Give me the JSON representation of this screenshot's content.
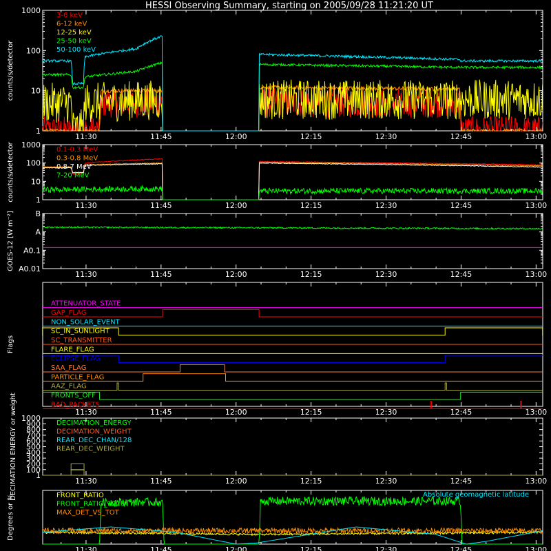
{
  "title": "HESSI Observing Summary, starting on 2005/09/28 11:21:20 UT",
  "time_axis": {
    "tick_labels": [
      "11:30",
      "11:45",
      "12:00",
      "12:15",
      "12:30",
      "12:45",
      "13:00"
    ],
    "tick_minutes": [
      30,
      45,
      60,
      75,
      90,
      105,
      120
    ],
    "range_minutes": [
      21.33,
      121.33
    ]
  },
  "colors": {
    "red": "#ff0000",
    "orange": "#ff8c00",
    "yellow": "#ffff00",
    "green": "#00ff00",
    "cyan": "#00e8ff",
    "magenta": "#ff00ff",
    "blue": "#0000ff",
    "white": "#ffffff",
    "olive": "#aaaa44",
    "darkorange": "#ff5a1e",
    "flagorange": "#ff7a3c",
    "fronts": "#22ee22"
  },
  "chart_data": [
    {
      "id": "p1",
      "type": "line",
      "ylabel": "counts/s/detector",
      "log": true,
      "ylim": [
        1,
        1000
      ],
      "yticks": [
        1,
        10,
        100,
        1000
      ],
      "ytick_labels": [
        "1",
        "10",
        "100",
        "1000"
      ],
      "gaps": [
        [
          45.3,
          64.6
        ]
      ],
      "series": [
        {
          "name": "3-6 keV",
          "color": "red",
          "noise": 0.15,
          "points": [
            [
              21.3,
              1
            ],
            [
              32.7,
              1
            ],
            [
              33,
              5
            ],
            [
              45.3,
              5
            ],
            [
              64.6,
              5
            ],
            [
              104.7,
              5
            ],
            [
              105,
              1
            ],
            [
              121.3,
              1
            ]
          ]
        },
        {
          "name": "6-12 keV",
          "color": "orange",
          "noise": 0.05,
          "points": [
            [
              21.3,
              1
            ],
            [
              32.7,
              1
            ],
            [
              33,
              10
            ],
            [
              45.3,
              10
            ],
            [
              64.6,
              12
            ],
            [
              104.7,
              11
            ],
            [
              105,
              1
            ],
            [
              121.3,
              1
            ]
          ]
        },
        {
          "name": "12-25 keV",
          "color": "yellow",
          "noise": 0.2,
          "points": [
            [
              21.3,
              5
            ],
            [
              27,
              5
            ],
            [
              27.3,
              1.1
            ],
            [
              29.5,
              1.1
            ],
            [
              29.8,
              5
            ],
            [
              45.3,
              6
            ],
            [
              64.6,
              6
            ],
            [
              121.3,
              6
            ]
          ]
        },
        {
          "name": "25-50 keV",
          "color": "green",
          "noise": 0.03,
          "points": [
            [
              21.3,
              25
            ],
            [
              27,
              25
            ],
            [
              27.3,
              12
            ],
            [
              29.5,
              12
            ],
            [
              29.8,
              22
            ],
            [
              40,
              30
            ],
            [
              45.3,
              50
            ],
            [
              64.6,
              45
            ],
            [
              104.7,
              38
            ],
            [
              121.3,
              38
            ]
          ]
        },
        {
          "name": "50-100 keV",
          "color": "cyan",
          "noise": 0.03,
          "points": [
            [
              21.3,
              55
            ],
            [
              27,
              55
            ],
            [
              27.3,
              15
            ],
            [
              29.5,
              15
            ],
            [
              29.8,
              70
            ],
            [
              40,
              110
            ],
            [
              45.3,
              230
            ],
            [
              64.6,
              80
            ],
            [
              104.7,
              60
            ],
            [
              105,
              55
            ],
            [
              121.3,
              55
            ]
          ]
        }
      ]
    },
    {
      "id": "p2",
      "type": "line",
      "ylabel": "counts/s/detector",
      "log": true,
      "ylim": [
        1,
        1000
      ],
      "yticks": [
        1,
        10,
        100,
        1000
      ],
      "ytick_labels": [
        "1",
        "10",
        "100",
        "1000"
      ],
      "gaps": [
        [
          45.3,
          64.6
        ]
      ],
      "series": [
        {
          "name": "0.1-0.3 MeV",
          "color": "red",
          "noise": 0.02,
          "points": [
            [
              21.3,
              60
            ],
            [
              27,
              60
            ],
            [
              27.3,
              25
            ],
            [
              29.5,
              25
            ],
            [
              29.8,
              100
            ],
            [
              45.3,
              170
            ],
            [
              64.6,
              120
            ],
            [
              121.3,
              80
            ]
          ]
        },
        {
          "name": "0.3-0.8 MeV",
          "color": "orange",
          "noise": 0.02,
          "points": [
            [
              21.3,
              60
            ],
            [
              27,
              60
            ],
            [
              27.3,
              30
            ],
            [
              29.5,
              30
            ],
            [
              29.8,
              80
            ],
            [
              45.3,
              100
            ],
            [
              64.6,
              110
            ],
            [
              121.3,
              70
            ]
          ]
        },
        {
          "name": "0.8-7 MeV",
          "color": "white",
          "noise": 0.02,
          "points": [
            [
              21.3,
              55
            ],
            [
              27,
              55
            ],
            [
              27.3,
              30
            ],
            [
              29.5,
              30
            ],
            [
              29.8,
              75
            ],
            [
              45.3,
              90
            ],
            [
              64.6,
              100
            ],
            [
              121.3,
              60
            ]
          ]
        },
        {
          "name": "7-20 MeV",
          "color": "green",
          "noise": 0.15,
          "points": [
            [
              21.3,
              3.5
            ],
            [
              45.3,
              4
            ],
            [
              64.6,
              3
            ],
            [
              121.3,
              3
            ]
          ]
        }
      ]
    },
    {
      "id": "p3",
      "type": "line",
      "ylabel": "GOES-12 [W m⁻²]",
      "log": true,
      "ylim": [
        0.01,
        10
      ],
      "yticks": [
        0.01,
        0.1,
        1,
        10
      ],
      "ytick_labels": [
        "A0.01",
        "A0.1",
        "A",
        "B"
      ],
      "series": [
        {
          "name": "",
          "color": "green",
          "noise": 0.04,
          "points": [
            [
              21.3,
              1.8
            ],
            [
              121.3,
              1.5
            ]
          ]
        },
        {
          "name": "",
          "color": "magenta",
          "noise": 0.0,
          "points": [
            [
              21.3,
              0.14
            ],
            [
              121.3,
              0.14
            ]
          ]
        }
      ]
    },
    {
      "id": "p4",
      "type": "flags",
      "ylabel": "Flags",
      "flags": [
        {
          "name": "ATTENUATOR_STATE",
          "color": "magenta",
          "level": 0,
          "steps": []
        },
        {
          "name": "GAP_FLAG",
          "color": "red",
          "level": 0,
          "steps": [
            [
              45.3,
              64.6
            ]
          ]
        },
        {
          "name": "NON_SOLAR_EVENT",
          "color": "cyan",
          "level": 0,
          "steps": []
        },
        {
          "name": "SC_IN_SUNLIGHT",
          "color": "yellow",
          "level": 0,
          "steps": [
            [
              21.3,
              36.5
            ],
            [
              101.8,
              121.3
            ]
          ]
        },
        {
          "name": "SC_TRANSMITTER",
          "color": "darkorange",
          "level": 0,
          "steps": []
        },
        {
          "name": "FLARE_FLAG",
          "color": "yellow",
          "level": 0,
          "steps": []
        },
        {
          "name": "ECLIPSE_FLAG",
          "color": "blue",
          "level": 1,
          "steps": [
            [
              36.5,
              101.8
            ]
          ]
        },
        {
          "name": "SAA_FLAG",
          "color": "flagorange",
          "level": 0,
          "steps": [
            [
              48.8,
              57.7
            ]
          ]
        },
        {
          "name": "PARTICLE_FLAG",
          "color": "orange",
          "level": 0,
          "steps": [
            [
              41.4,
              57.9
            ]
          ]
        },
        {
          "name": "AAZ_FLAG",
          "color": "olive",
          "level": 0,
          "steps": [
            [
              36.2,
              36.5
            ],
            [
              101.8,
              102.1
            ]
          ]
        },
        {
          "name": "FRONTS_OFF",
          "color": "fronts",
          "level": 1,
          "steps": [
            [
              32.7,
              104.9
            ]
          ]
        },
        {
          "name": "BAD_PACKETS",
          "color": "red",
          "level": 0,
          "steps": [
            [
              98.9,
              99.1
            ],
            [
              116.9,
              117.1
            ]
          ]
        }
      ]
    },
    {
      "id": "p5",
      "type": "line",
      "ylabel": "DECIMATION ENERGY or weight",
      "log": false,
      "ylim": [
        1,
        1000
      ],
      "yticks": [
        1,
        100,
        200,
        300,
        400,
        500,
        600,
        700,
        800,
        900,
        1000
      ],
      "ytick_labels": [
        "1",
        "100",
        "200",
        "300",
        "400",
        "500",
        "600",
        "700",
        "800",
        "900",
        "1000"
      ],
      "series": [
        {
          "name": "DECIMATION_ENERGY",
          "color": "green",
          "noise": 0,
          "points": [
            [
              21.3,
              1
            ],
            [
              121.3,
              1
            ]
          ]
        },
        {
          "name": "DECIMATION_WEIGHT",
          "color": "darkorange",
          "noise": 0,
          "points": [
            [
              21.3,
              1
            ],
            [
              121.3,
              1
            ]
          ]
        },
        {
          "name": "REAR_DEC_CHAN/128",
          "color": "cyan",
          "noise": 0,
          "points": [
            [
              21.3,
              1
            ],
            [
              121.3,
              1
            ]
          ]
        },
        {
          "name": "REAR_DEC_WEIGHT",
          "color": "olive",
          "noise": 0,
          "points": [
            [
              21.3,
              1
            ],
            [
              121.3,
              1
            ]
          ]
        }
      ],
      "boxes": [
        {
          "x0": 27,
          "x1": 29.6,
          "y0": 1,
          "y1": 200,
          "color": "olive"
        },
        {
          "x0": 27,
          "x1": 29.6,
          "y0": 100,
          "y1": 100,
          "color": "olive"
        }
      ]
    },
    {
      "id": "p6",
      "type": "line",
      "ylabel": "Degrees or %",
      "log": false,
      "ylim": [
        0,
        100
      ],
      "yticks": [],
      "ytick_labels": [],
      "annotation": "Absolute geomagnetic latitude",
      "series": [
        {
          "name": "FRONT_RATIO",
          "color": "yellow",
          "noise": 0.05,
          "points": [
            [
              21.3,
              22
            ],
            [
              45.3,
              20
            ],
            [
              64.6,
              18
            ],
            [
              121.3,
              22
            ]
          ]
        },
        {
          "name": "FRONT_RATIO_1225",
          "color": "green",
          "noise": 0.05,
          "points": [
            [
              21.3,
              0
            ],
            [
              32.7,
              0
            ],
            [
              33,
              78
            ],
            [
              45.3,
              78
            ],
            [
              45.6,
              0
            ],
            [
              64.6,
              0
            ],
            [
              64.9,
              80
            ],
            [
              104.9,
              80
            ],
            [
              105.2,
              0
            ],
            [
              121.3,
              0
            ]
          ]
        },
        {
          "name": "MAX_DET_VS_TOT",
          "color": "orange",
          "noise": 0.1,
          "points": [
            [
              21.3,
              25
            ],
            [
              121.3,
              25
            ]
          ]
        },
        {
          "name": "",
          "color": "cyan",
          "noise": 0,
          "points": [
            [
              21.3,
              22
            ],
            [
              35,
              32
            ],
            [
              48,
              22
            ],
            [
              60,
              0
            ],
            [
              64,
              2
            ],
            [
              84,
              32
            ],
            [
              100,
              18
            ],
            [
              106,
              0
            ],
            [
              110,
              5
            ],
            [
              121.3,
              25
            ]
          ]
        }
      ]
    }
  ]
}
